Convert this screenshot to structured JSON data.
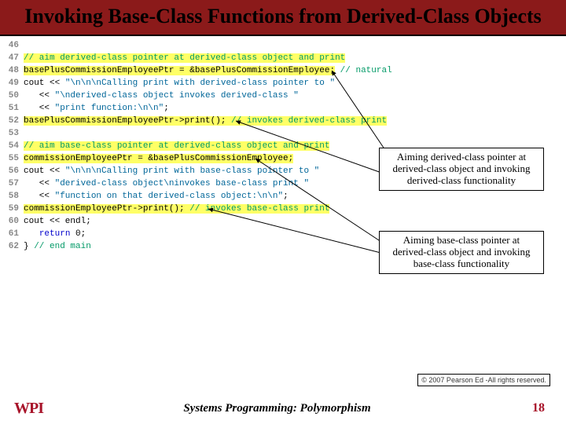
{
  "header": {
    "title": "Invoking Base-Class Functions from Derived-Class Objects"
  },
  "code": {
    "lines": [
      {
        "n": "46",
        "plain": ""
      },
      {
        "n": "47",
        "cm_hl": "// aim derived-class pointer at derived-class object and print"
      },
      {
        "n": "48",
        "hl": "basePlusCommissionEmployeePtr = &basePlusCommissionEmployee;",
        "trail_cm": " // natural"
      },
      {
        "n": "49",
        "pre": "cout << ",
        "str": "\"\\n\\n\\nCalling print with derived-class pointer to \""
      },
      {
        "n": "50",
        "pre": "   << ",
        "str": "\"\\nderived-class object invokes derived-class \""
      },
      {
        "n": "51",
        "pre": "   << ",
        "str": "\"print function:\\n\\n\"",
        "post": ";"
      },
      {
        "n": "52",
        "hl": "basePlusCommissionEmployeePtr->print();",
        "trail_cm_hl": " // invokes derived-class print"
      },
      {
        "n": "53",
        "plain": ""
      },
      {
        "n": "54",
        "cm_hl": "// aim base-class pointer at derived-class object and print"
      },
      {
        "n": "55",
        "hl": "commissionEmployeePtr = &basePlusCommissionEmployee;"
      },
      {
        "n": "56",
        "pre": "cout << ",
        "str": "\"\\n\\n\\nCalling print with base-class pointer to \""
      },
      {
        "n": "57",
        "pre": "   << ",
        "str": "\"derived-class object\\ninvokes base-class print \""
      },
      {
        "n": "58",
        "pre": "   << ",
        "str": "\"function on that derived-class object:\\n\\n\"",
        "post": ";"
      },
      {
        "n": "59",
        "hl": "commissionEmployeePtr->print();",
        "trail_cm_hl": " // invokes base-class print"
      },
      {
        "n": "60",
        "plain": "cout << endl;"
      },
      {
        "n": "61",
        "kw": "return",
        "post2": " 0;"
      },
      {
        "n": "62",
        "pre2": "} ",
        "cm": "// end main"
      }
    ]
  },
  "callouts": {
    "c1": "Aiming derived-class pointer at derived-class object and invoking derived-class functionality",
    "c2": "Aiming base-class pointer at derived-class object and invoking base-class functionality"
  },
  "copyright": "© 2007 Pearson Ed -All rights reserved.",
  "footer": {
    "logo": "WPI",
    "title": "Systems Programming:  Polymorphism",
    "page": "18"
  }
}
